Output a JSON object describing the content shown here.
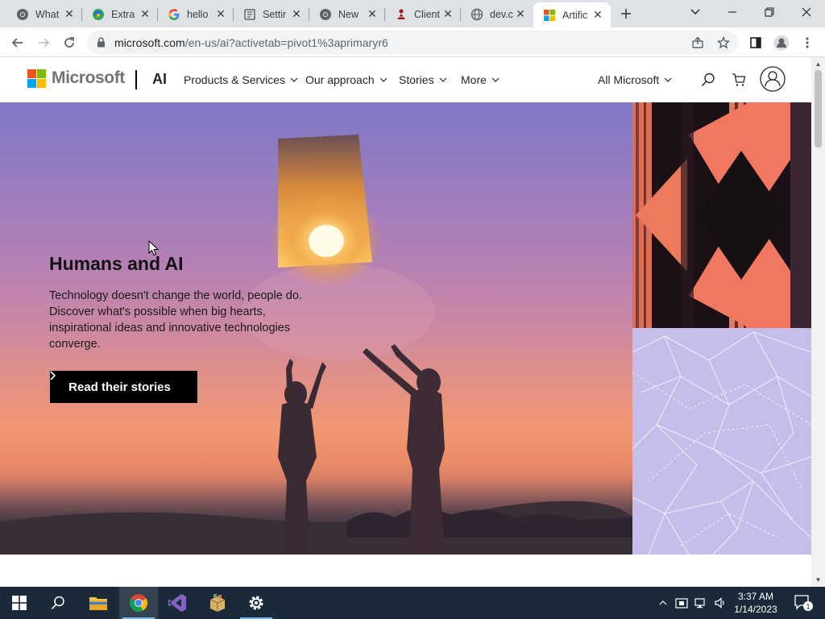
{
  "browser": {
    "tabs": [
      {
        "title": "What",
        "icon": "chromium-icon"
      },
      {
        "title": "Extra",
        "icon": "edge-icon"
      },
      {
        "title": "hello",
        "icon": "google-icon"
      },
      {
        "title": "Settir",
        "icon": "settings-page-icon"
      },
      {
        "title": "New",
        "icon": "chromium-icon"
      },
      {
        "title": "Client",
        "icon": "client-app-icon"
      },
      {
        "title": "dev.c",
        "icon": "globe-icon"
      },
      {
        "title": "Artific",
        "icon": "microsoft-icon"
      }
    ],
    "active_tab": 7,
    "url_host": "microsoft.com",
    "url_path": "/en-us/ai?activetab=pivot1%3aprimaryr6"
  },
  "header": {
    "brand": "Microsoft",
    "section": "AI",
    "nav": [
      "Products & Services",
      "Our approach",
      "Stories",
      "More"
    ],
    "all_microsoft": "All Microsoft"
  },
  "hero": {
    "title": "Humans and AI",
    "body": "Technology doesn't change the world, people do. Discover what's possible when big hearts, inspirational ideas and innovative technologies converge.",
    "cta": "Read their stories"
  },
  "taskbar": {
    "apps": [
      "windows-start",
      "search",
      "file-explorer",
      "chrome",
      "visual-studio",
      "app-package",
      "settings"
    ],
    "clock_time": "3:37 AM",
    "clock_date": "1/14/2023",
    "notification_count": "1"
  },
  "colors": {
    "ms_red": "#f25022",
    "ms_green": "#7fba00",
    "ms_blue": "#00a4ef",
    "ms_yellow": "#ffb900",
    "taskbar_bg": "#1b2a38",
    "hero_cta_bg": "#000000"
  }
}
